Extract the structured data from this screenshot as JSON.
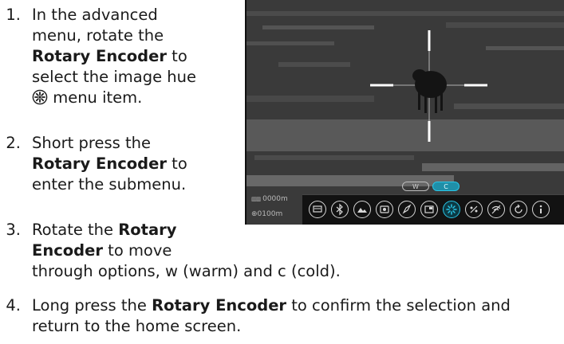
{
  "steps": [
    {
      "num": "1.",
      "lines": [
        {
          "text": "In the advanced"
        },
        {
          "text": "menu, rotate the"
        },
        {
          "bold": "Rotary Encoder",
          "rest": " to"
        },
        {
          "text": "select the image hue"
        },
        {
          "icon": "image-hue-icon",
          "rest": " menu item."
        }
      ]
    },
    {
      "num": "2.",
      "lines": [
        {
          "text": "Short press the"
        },
        {
          "bold": "Rotary Encoder",
          "rest": " to"
        },
        {
          "text": "enter the submenu."
        }
      ]
    },
    {
      "num": "3.",
      "lines": [
        {
          "pre": "Rotate the ",
          "bold": "Rotary"
        },
        {
          "bold": "Encoder",
          "rest": " to move"
        },
        {
          "text": "through options, w (warm) and c (cold)."
        }
      ]
    },
    {
      "num": "4.",
      "lines": [
        {
          "pre": "Long press the ",
          "bold": "Rotary Encoder",
          "rest": " to confirm the selection and"
        },
        {
          "text": "return to the home screen."
        }
      ]
    }
  ],
  "screen": {
    "rangefinder_readout": "0000m",
    "distance_readout": "0100m",
    "hue_options": [
      "W",
      "C"
    ],
    "selected_hue": "C",
    "accent_color": "#29c5e6",
    "menu_icons": [
      "display-icon",
      "bluetooth-icon",
      "image-mode-icon",
      "recording-icon",
      "compass-icon",
      "pip-icon",
      "image-hue-icon",
      "units-icon",
      "wifi-off-icon",
      "reset-icon",
      "info-icon"
    ],
    "active_menu_icon": "image-hue-icon"
  }
}
